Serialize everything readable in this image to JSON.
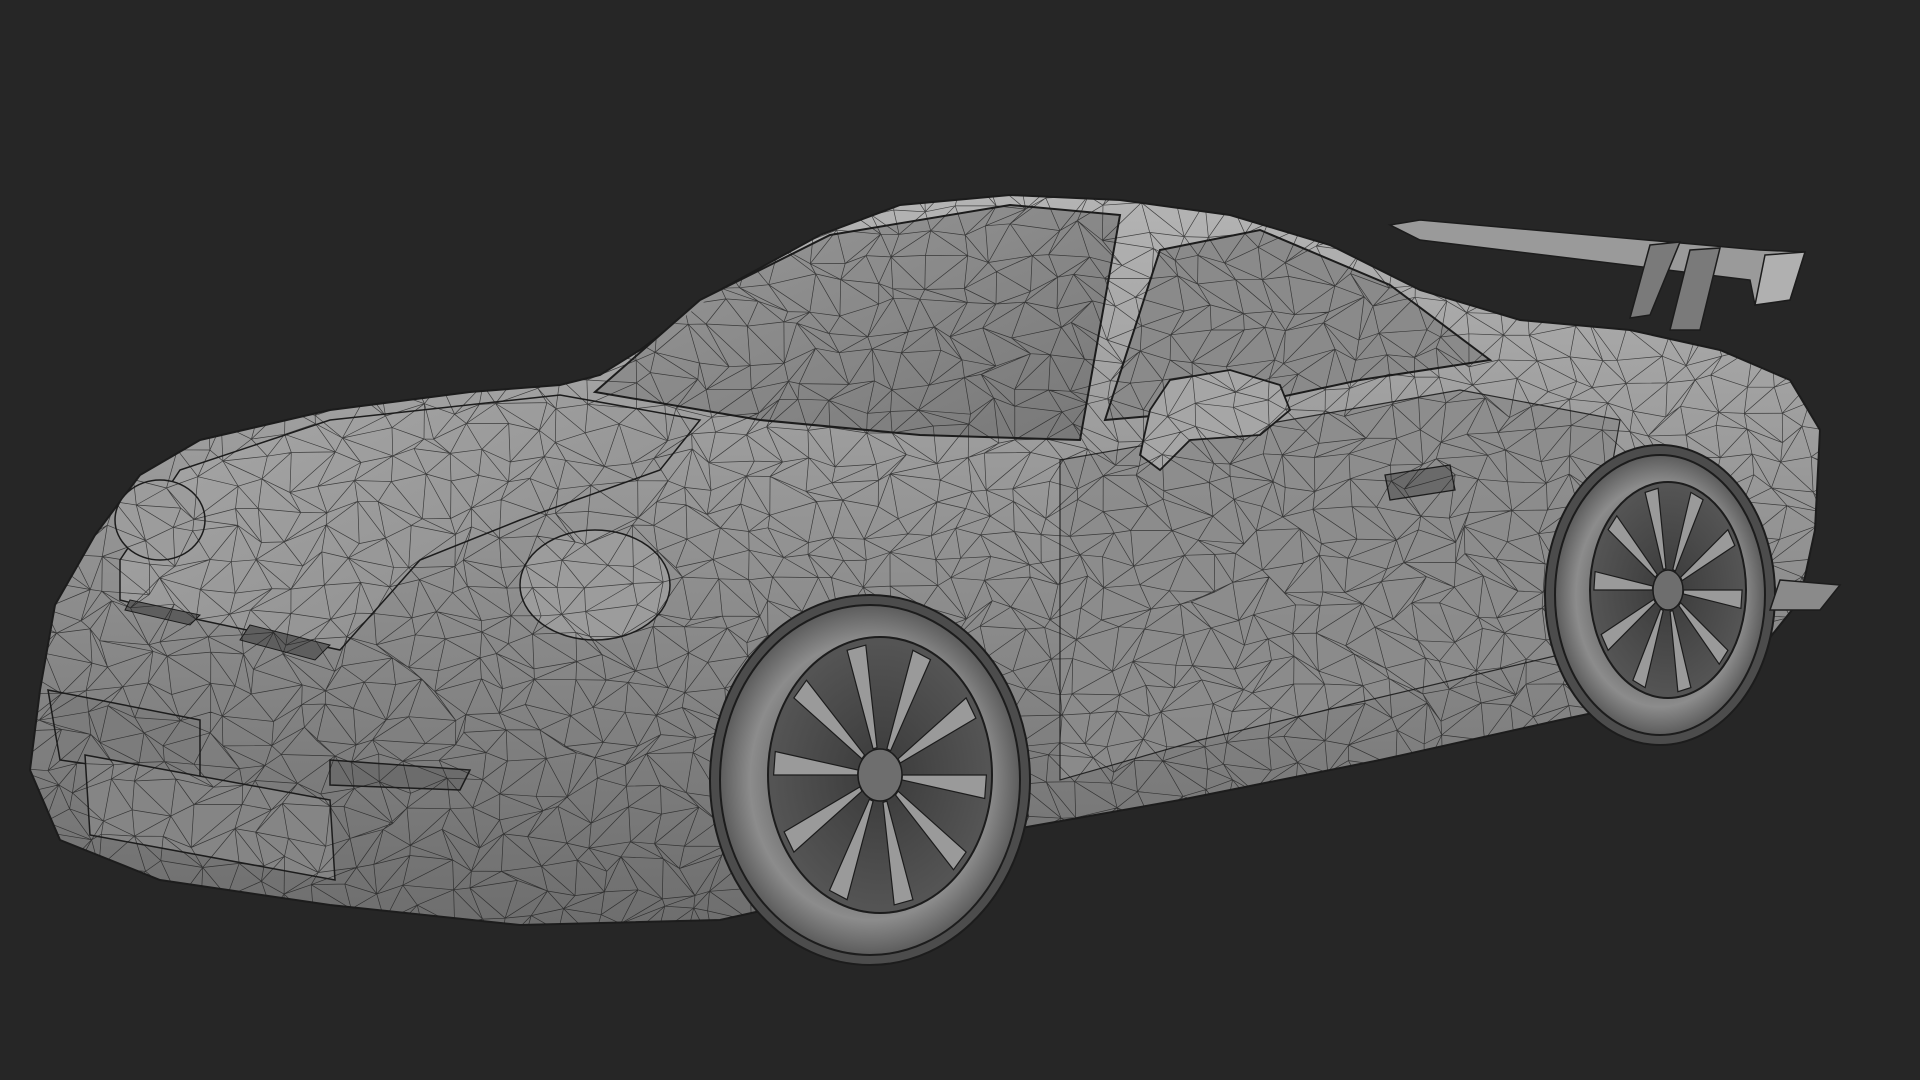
{
  "viewport": {
    "background": "#262626",
    "shading_mode": "solid-wireframe"
  },
  "model": {
    "body_color": "#8e8e8e",
    "body_highlight": "#b8b8b8",
    "body_shadow": "#5a5a5a",
    "wire_color": "#1c1c1c",
    "glass_color": "#7c7c7c"
  }
}
